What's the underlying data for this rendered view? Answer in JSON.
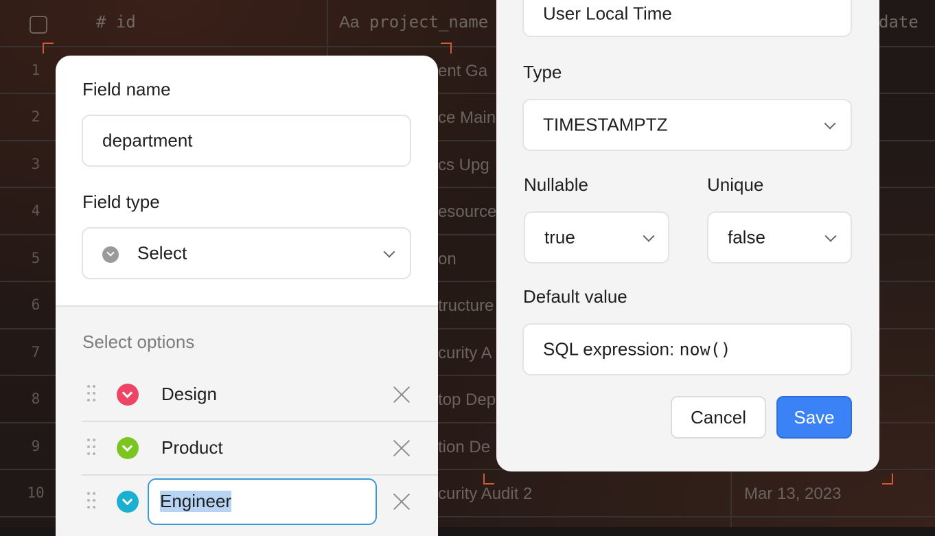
{
  "table": {
    "columns": {
      "id": "id",
      "project_name": "project_name",
      "date": "date"
    },
    "column_icons": {
      "id": "hash-icon",
      "project_name": "text-type-icon"
    },
    "rows": [
      {
        "num": "1",
        "project": "ent Ga"
      },
      {
        "num": "2",
        "project": "ce Main"
      },
      {
        "num": "3",
        "project": "cs Upg"
      },
      {
        "num": "4",
        "project": "esource"
      },
      {
        "num": "5",
        "project": "on"
      },
      {
        "num": "6",
        "project": "tructure"
      },
      {
        "num": "7",
        "project": "curity A"
      },
      {
        "num": "8",
        "project": "top Dep"
      },
      {
        "num": "9",
        "project": "tion De"
      },
      {
        "num": "10",
        "project": "curity Audit 2",
        "date": "Mar 13, 2023"
      }
    ]
  },
  "field_editor": {
    "field_name_label": "Field name",
    "field_name_value": "department",
    "field_type_label": "Field type",
    "field_type_value": "Select",
    "select_options_label": "Select options",
    "options": [
      {
        "label": "Design",
        "color": "#ee4466"
      },
      {
        "label": "Product",
        "color": "#7cc520"
      },
      {
        "label": "Engineer",
        "color": "#1bb0d0"
      }
    ]
  },
  "column_editor": {
    "name_value": "User Local Time",
    "type_label": "Type",
    "type_value": "TIMESTAMPTZ",
    "nullable_label": "Nullable",
    "nullable_value": "true",
    "unique_label": "Unique",
    "unique_value": "false",
    "default_label": "Default value",
    "default_prefix": "SQL expression: ",
    "default_code": "now()",
    "cancel_label": "Cancel",
    "save_label": "Save"
  },
  "colors": {
    "accent": "#3b82f6",
    "focus_border": "#3a9ad9",
    "selection": "#b7d4f5"
  }
}
